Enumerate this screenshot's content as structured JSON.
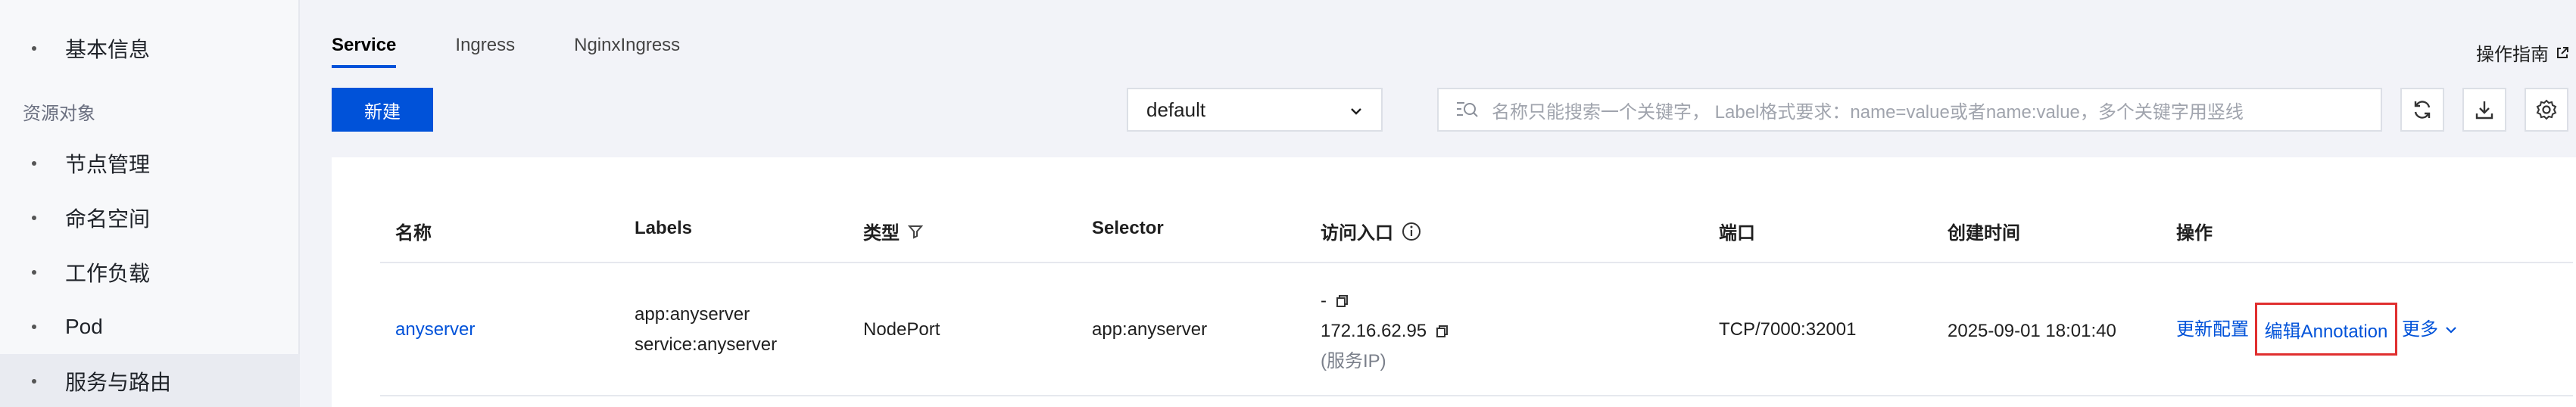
{
  "sidebar": {
    "items": [
      {
        "label": "基本信息"
      },
      {
        "label": "节点管理"
      },
      {
        "label": "命名空间"
      },
      {
        "label": "工作负载"
      },
      {
        "label": "Pod"
      },
      {
        "label": "服务与路由"
      }
    ],
    "group_label": "资源对象",
    "active_item": "服务与路由"
  },
  "tabs": [
    {
      "label": "Service",
      "active": true
    },
    {
      "label": "Ingress"
    },
    {
      "label": "NginxIngress"
    }
  ],
  "header": {
    "guide_label": "操作指南"
  },
  "toolbar": {
    "new_label": "新建",
    "namespace_value": "default",
    "search_placeholder": "名称只能搜索一个关键字， Label格式要求：name=value或者name:value，多个关键字用竖线"
  },
  "table": {
    "columns": [
      "名称",
      "Labels",
      "类型",
      "Selector",
      "访问入口",
      "端口",
      "创建时间",
      "操作"
    ],
    "rows": [
      {
        "name": "anyserver",
        "labels": [
          "app:anyserver",
          "service:anyserver"
        ],
        "type": "NodePort",
        "selector": "app:anyserver",
        "access_external": "-",
        "access_ip": "172.16.62.95",
        "access_note": "(服务IP)",
        "port": "TCP/7000:32001",
        "created": "2025-09-01 18:01:40",
        "actions": {
          "update": "更新配置",
          "annotation": "编辑Annotation",
          "more": "更多"
        }
      }
    ]
  },
  "colors": {
    "accent": "#0052d9",
    "highlight_border": "#e02f2f"
  }
}
